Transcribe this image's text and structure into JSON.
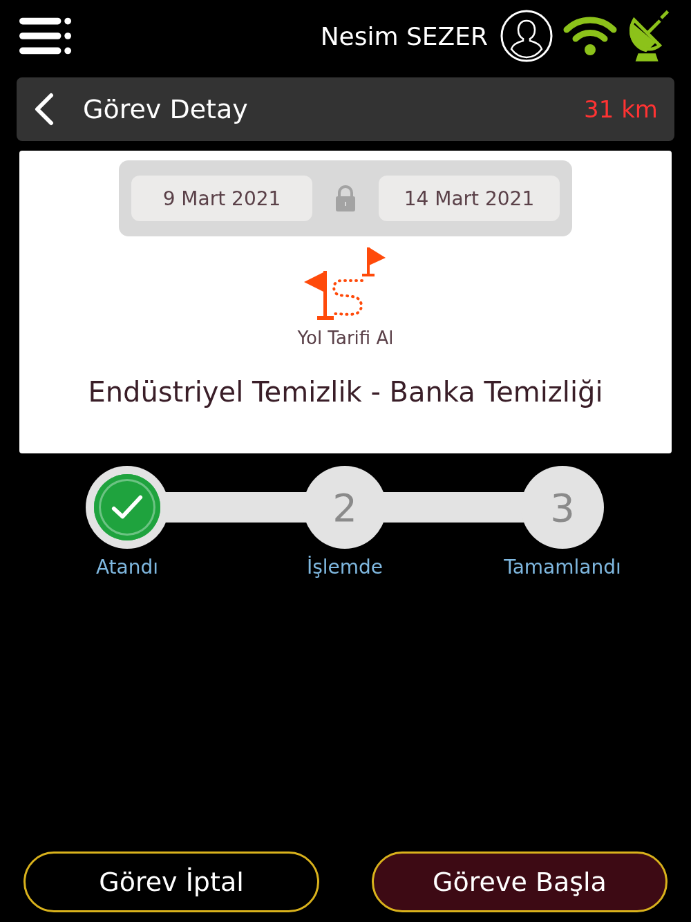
{
  "header": {
    "user_name": "Nesim SEZER"
  },
  "title_bar": {
    "title": "Görev Detay",
    "distance": "31 km"
  },
  "task": {
    "start_date": "9 Mart 2021",
    "end_date": "14 Mart 2021",
    "directions_label": "Yol Tarifi Al",
    "title": "Endüstriyel Temizlik - Banka Temizliği"
  },
  "steps": [
    {
      "label": "Atandı",
      "completed": true
    },
    {
      "number": "2",
      "label": "İşlemde",
      "completed": false
    },
    {
      "number": "3",
      "label": "Tamamlandı",
      "completed": false
    }
  ],
  "buttons": [
    {
      "label": "Görev İptal",
      "kind": "secondary"
    },
    {
      "label": "Göreve Başla",
      "kind": "primary"
    }
  ]
}
